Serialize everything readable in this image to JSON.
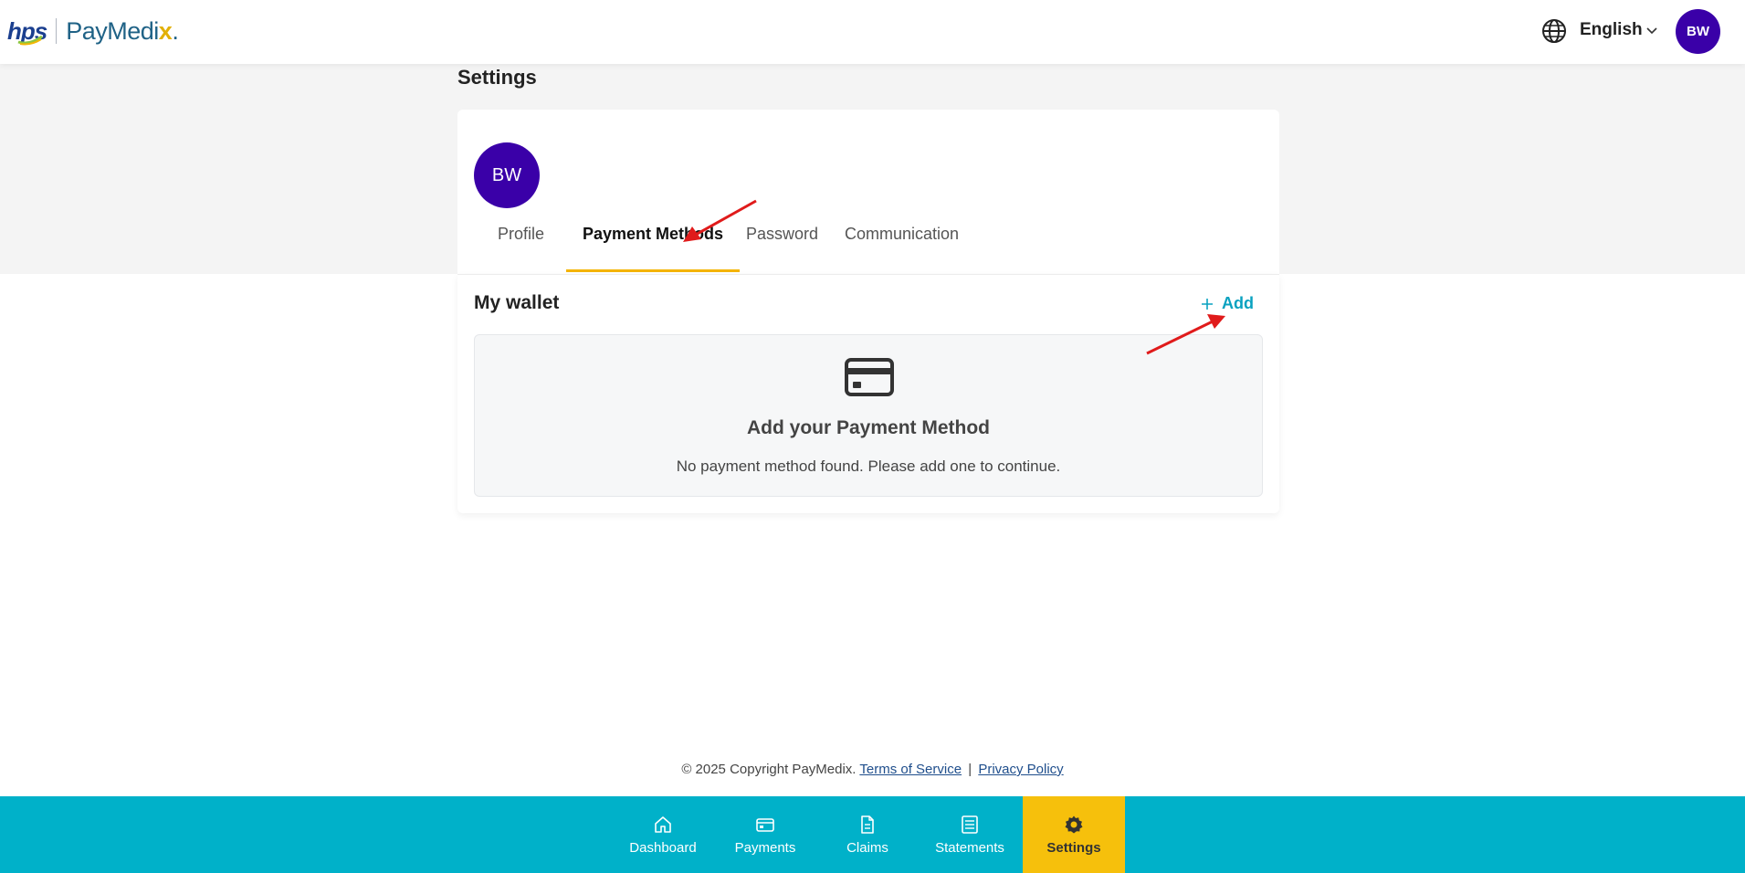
{
  "header": {
    "logo_hps": "hps",
    "logo_paymedix": "PayMedi",
    "logo_paymedix_x": "x",
    "logo_paymedix_dot": ".",
    "language": "English",
    "avatar_initials": "BW"
  },
  "page": {
    "title": "Settings"
  },
  "profile": {
    "avatar_initials": "BW"
  },
  "tabs": [
    {
      "label": "Profile",
      "active": false
    },
    {
      "label": "Payment Methods",
      "active": true
    },
    {
      "label": "Password",
      "active": false
    },
    {
      "label": "Communication",
      "active": false
    }
  ],
  "wallet": {
    "title": "My wallet",
    "add_label": "Add",
    "empty_title": "Add your Payment Method",
    "empty_text": "No payment method found. Please add one to continue.",
    "icon": "credit-card-icon"
  },
  "footer": {
    "copyright": "© 2025 Copyright PayMedix.",
    "terms": "Terms of Service",
    "separator": "|",
    "privacy": "Privacy Policy"
  },
  "bottom_nav": [
    {
      "label": "Dashboard",
      "icon": "home-icon",
      "active": false
    },
    {
      "label": "Payments",
      "icon": "card-icon",
      "active": false
    },
    {
      "label": "Claims",
      "icon": "document-icon",
      "active": false
    },
    {
      "label": "Statements",
      "icon": "list-document-icon",
      "active": false
    },
    {
      "label": "Settings",
      "icon": "gear-icon",
      "active": true
    }
  ],
  "colors": {
    "brand_purple": "#3a00a8",
    "accent_cyan": "#00b1c9",
    "accent_yellow": "#f6c00c",
    "tab_underline": "#f4b400",
    "link_teal": "#0aa2c0",
    "annotation_red": "#e01b1b"
  }
}
